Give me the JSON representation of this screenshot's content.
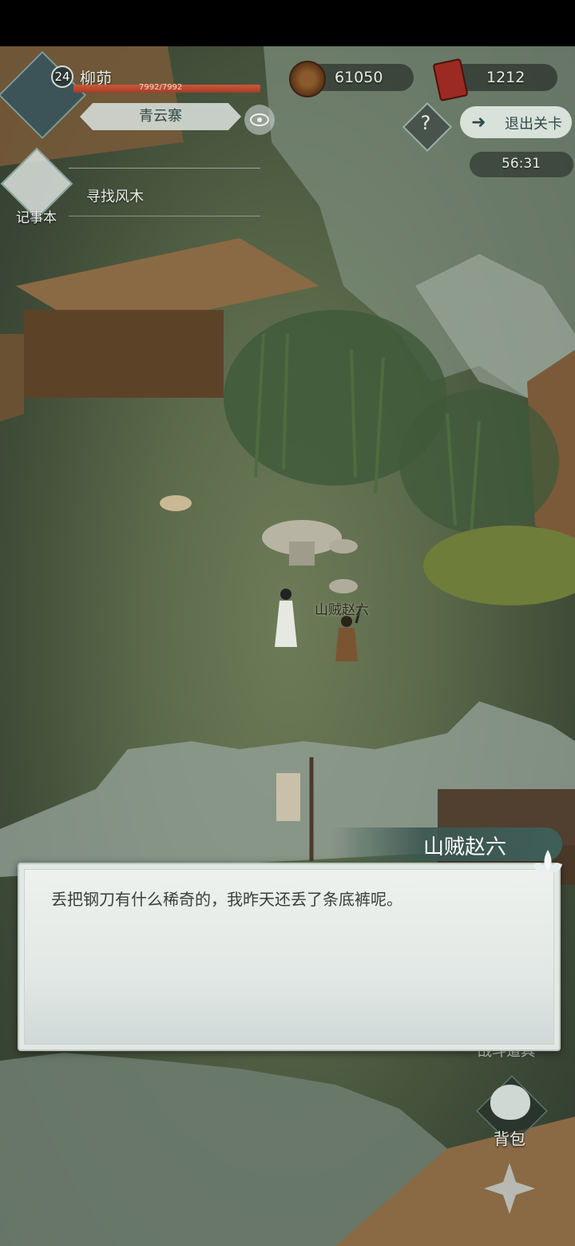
{
  "player": {
    "level": "24",
    "name": "柳茆",
    "hp_text": "7992/7992",
    "hp_fraction": 1.0,
    "location": "青云寨"
  },
  "currency": {
    "copper_coins": "61050",
    "jade_tokens": "1212"
  },
  "controls": {
    "help_symbol": "?",
    "exit_label": "退出关卡",
    "timer": "56:31",
    "journal_label": "记事本",
    "bag_label": "背包",
    "side_partial_label": "战斗道具"
  },
  "quest": {
    "current": "寻找风木"
  },
  "npc": {
    "label": "山贼赵六"
  },
  "dialogue": {
    "speaker": "山贼赵六",
    "text": "丢把钢刀有什么稀奇的，我昨天还丢了条底裤呢。"
  },
  "colors": {
    "accent_teal": "#3e5f58",
    "hp_red": "#c9593c",
    "dialogue_bg": "#e3e8e4"
  },
  "icons": {
    "eye": "eye-icon",
    "copper": "coin-icon",
    "jade": "token-icon",
    "help": "question-icon",
    "exit": "exit-arrow-icon",
    "journal": "book-icon",
    "bag": "bag-icon",
    "skill": "star-icon"
  }
}
